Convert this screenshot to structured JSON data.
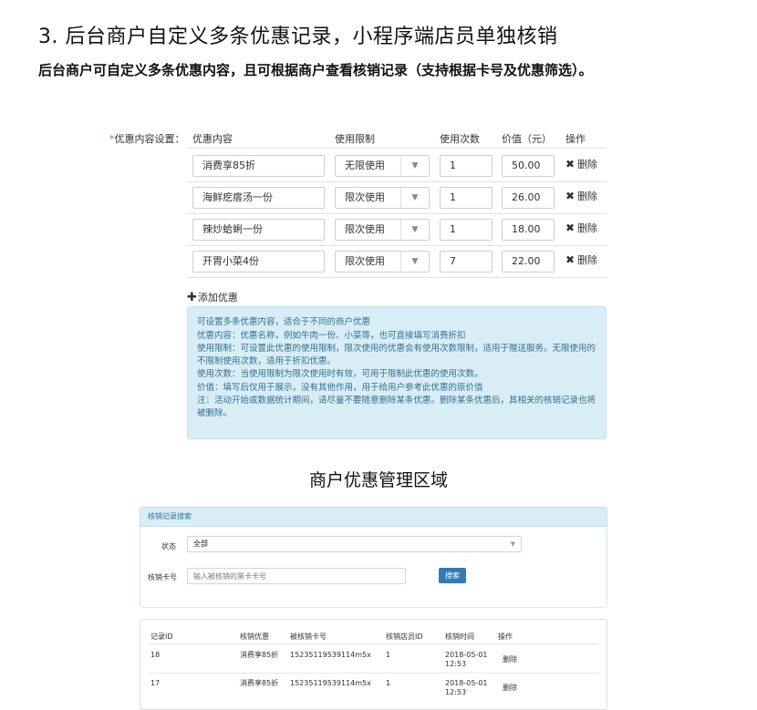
{
  "heading": "3. 后台商户自定义多条优惠记录，小程序端店员单独核销",
  "subheading": "后台商户可自定义多条优惠内容，且可根据商户查看核销记录（支持根据卡号及优惠筛选）。",
  "editor": {
    "field_label_star": "*",
    "field_label": "优惠内容设置：",
    "columns": [
      "优惠内容",
      "使用限制",
      "使用次数",
      "价值（元）",
      "操作"
    ],
    "rows": [
      {
        "content": "消费享85折",
        "limit": "无限使用",
        "count": "1",
        "value": "50.00",
        "action": "删除"
      },
      {
        "content": "海鲜疙瘩汤一份",
        "limit": "限次使用",
        "count": "1",
        "value": "26.00",
        "action": "删除"
      },
      {
        "content": "辣炒蛤蜊一份",
        "limit": "限次使用",
        "count": "1",
        "value": "18.00",
        "action": "删除"
      },
      {
        "content": "开胃小菜4份",
        "limit": "限次使用",
        "count": "7",
        "value": "22.00",
        "action": "删除"
      }
    ],
    "delete_icon": "✖",
    "add_icon": "✚",
    "add_label": "添加优惠",
    "help_lines": [
      "可设置多条优惠内容，适合于不同的商户优惠",
      "优惠内容：优惠名称，例如牛肉一份、小菜等，也可直接填写消费折扣",
      "使用限制：可设置此优惠的使用限制，限次使用的优惠会有使用次数限制，适用于赠送服务。无限使用的不限制使用次数，适用于折扣优惠。",
      "使用次数：当使用限制为限次使用时有效，可用于限制此优惠的使用次数。",
      "价值：填写后仅用于展示，没有其他作用，用于给用户参考此优惠的原价值",
      "注：活动开始或数据统计期间，请尽量不要随意删除某条优惠。删除某条优惠后，其相关的核销记录也将被删除。"
    ]
  },
  "section_title": "商户优惠管理区域",
  "search": {
    "panel_title": "核销记录搜索",
    "status_label": "状态",
    "status_value": "全部",
    "card_label": "核销卡号",
    "card_placeholder": "输入被核销的黑卡卡号",
    "search_button": "搜索"
  },
  "records": {
    "columns": [
      "记录ID",
      "核销优惠",
      "被核销卡号",
      "核销店员ID",
      "核销时间",
      "操作"
    ],
    "rows": [
      {
        "id": "18",
        "coupon": "消费享85折",
        "card": "15235119539114m5x",
        "staff": "1",
        "date": "2018-05-01",
        "time": "12:53",
        "action": "删除"
      },
      {
        "id": "17",
        "coupon": "消费享85折",
        "card": "15235119539114m5x",
        "staff": "1",
        "date": "2018-05-01",
        "time": "12:53",
        "action": "删除"
      }
    ]
  },
  "colors": {
    "info_bg": "#d9edf7",
    "info_text": "#31708f",
    "primary_button": "#337ab7",
    "required_star": "#d9534f"
  }
}
